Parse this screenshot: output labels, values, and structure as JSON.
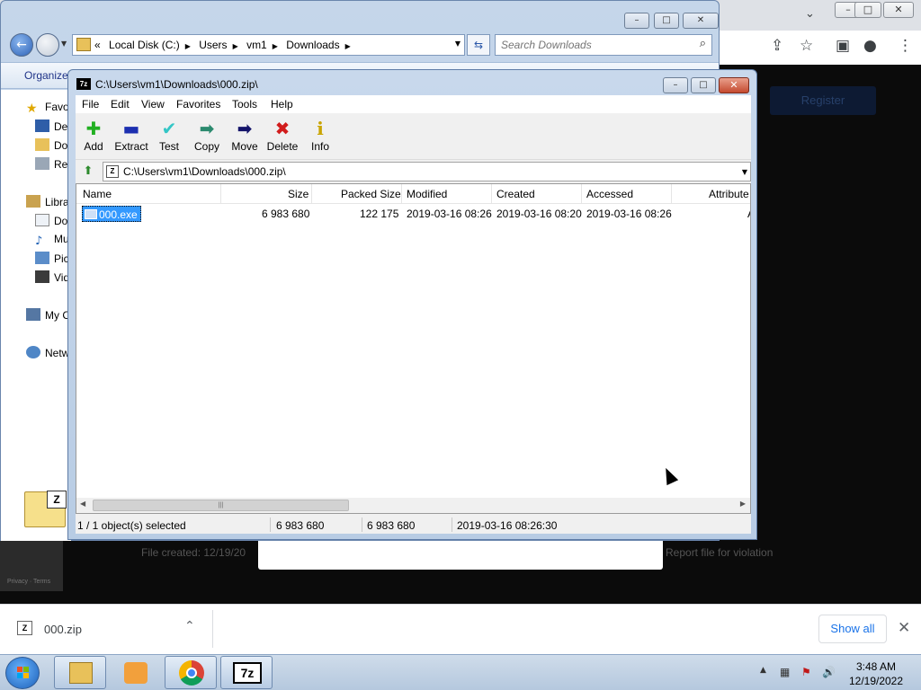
{
  "browser": {
    "window_controls": [
      "–",
      "□",
      "✕"
    ],
    "register_label": "Register",
    "file_created": "File created: 12/19/20",
    "report_file": "Report file for violation",
    "recaptcha_text": "Privacy · Terms"
  },
  "downloads": {
    "item_name": "000.zip",
    "show_all": "Show all"
  },
  "explorer": {
    "breadcrumb": [
      "Local Disk (C:)",
      "Users",
      "vm1",
      "Downloads"
    ],
    "breadcrumb_prefix": "«",
    "search_placeholder": "Search Downloads",
    "organize": "Organize",
    "nav": [
      {
        "label": "Favo",
        "icon": "star-icon"
      },
      {
        "label": "Des",
        "icon": "desktop-icon"
      },
      {
        "label": "Dov",
        "icon": "folder-icon"
      },
      {
        "label": "Rec",
        "icon": "recent-icon"
      },
      {
        "label": "Libra",
        "icon": "library-icon"
      },
      {
        "label": "Doc",
        "icon": "document-icon"
      },
      {
        "label": "Mu",
        "icon": "music-icon"
      },
      {
        "label": "Pic",
        "icon": "pictures-icon"
      },
      {
        "label": "Vid",
        "icon": "video-icon"
      },
      {
        "label": "My C",
        "icon": "computer-icon"
      },
      {
        "label": "Netw",
        "icon": "network-icon"
      }
    ]
  },
  "sevenzip": {
    "title": "C:\\Users\\vm1\\Downloads\\000.zip\\",
    "icon_text": "7z",
    "menu": [
      "File",
      "Edit",
      "View",
      "Favorites",
      "Tools",
      "Help"
    ],
    "toolbar": [
      {
        "label": "Add",
        "icon": "add-icon",
        "glyph": "✚",
        "color": "#22b022"
      },
      {
        "label": "Extract",
        "icon": "extract-icon",
        "glyph": "▬",
        "color": "#1c2fb0"
      },
      {
        "label": "Test",
        "icon": "test-icon",
        "glyph": "✔",
        "color": "#34c6c6"
      },
      {
        "label": "Copy",
        "icon": "copy-icon",
        "glyph": "➡",
        "color": "#2b8a6e"
      },
      {
        "label": "Move",
        "icon": "move-icon",
        "glyph": "➡",
        "color": "#14146a"
      },
      {
        "label": "Delete",
        "icon": "delete-icon",
        "glyph": "✖",
        "color": "#d11c1c"
      },
      {
        "label": "Info",
        "icon": "info-icon",
        "glyph": "i",
        "color": "#c9a400"
      }
    ],
    "path": "C:\\Users\\vm1\\Downloads\\000.zip\\",
    "columns": [
      "Name",
      "Size",
      "Packed Size",
      "Modified",
      "Created",
      "Accessed",
      "Attribute"
    ],
    "rows": [
      {
        "name": "000.exe",
        "size": "6 983 680",
        "packed": "122 175",
        "modified": "2019-03-16 08:26",
        "created": "2019-03-16 08:20",
        "accessed": "2019-03-16 08:26",
        "attr": "A"
      }
    ],
    "status": {
      "selected": "1 / 1 object(s) selected",
      "size": "6 983 680",
      "total": "6 983 680",
      "date": "2019-03-16 08:26:30"
    }
  },
  "taskbar": {
    "time": "3:48 AM",
    "date": "12/19/2022",
    "sevenzip_label": "7z"
  }
}
